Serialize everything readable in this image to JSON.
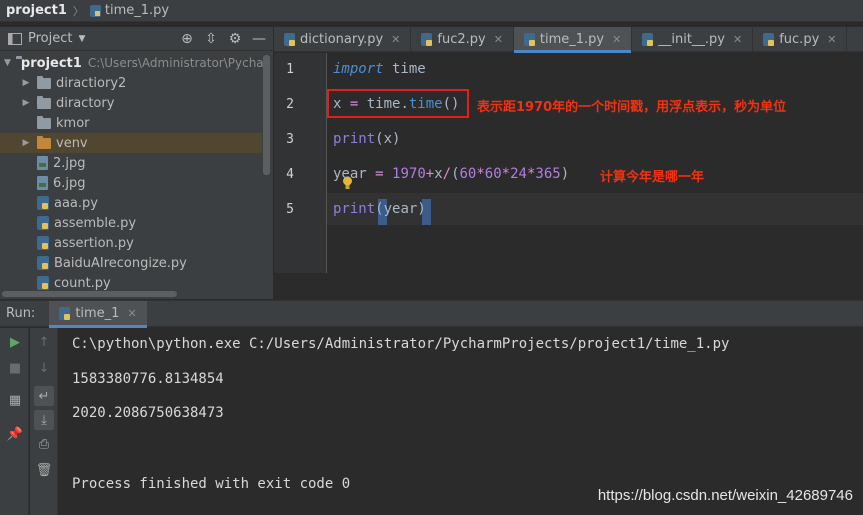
{
  "breadcrumb": {
    "project": "project1",
    "file": "time_1.py"
  },
  "project_panel": {
    "title": "Project",
    "tree": [
      {
        "name": "project1",
        "path": "C:\\Users\\Administrator\\Pychar",
        "type": "folder",
        "expanded": true
      },
      {
        "name": "diractiory2",
        "type": "folder",
        "expanded": false
      },
      {
        "name": "diractory",
        "type": "folder",
        "expanded": false
      },
      {
        "name": "kmor",
        "type": "folder"
      },
      {
        "name": "venv",
        "type": "folder-brown",
        "expanded": false,
        "highlighted": true
      },
      {
        "name": "2.jpg",
        "type": "image"
      },
      {
        "name": "6.jpg",
        "type": "image"
      },
      {
        "name": "aaa.py",
        "type": "python"
      },
      {
        "name": "assemble.py",
        "type": "python"
      },
      {
        "name": "assertion.py",
        "type": "python"
      },
      {
        "name": "BaiduAIrecongize.py",
        "type": "python"
      },
      {
        "name": "count.py",
        "type": "python"
      }
    ]
  },
  "tabs": [
    {
      "label": "dictionary.py",
      "active": false
    },
    {
      "label": "fuc2.py",
      "active": false
    },
    {
      "label": "time_1.py",
      "active": true
    },
    {
      "label": "__init__.py",
      "active": false
    },
    {
      "label": "fuc.py",
      "active": false
    }
  ],
  "editor": {
    "line_numbers": [
      "1",
      "2",
      "3",
      "4",
      "5"
    ],
    "lines": {
      "l1": {
        "kw": "import",
        "rest": " time"
      },
      "l2": {
        "a": "x ",
        "eq": "=",
        "b": " time.",
        "fn": "time",
        "c": "()"
      },
      "l3": {
        "bi": "print",
        "rest": "(x)"
      },
      "l4": {
        "a": "year ",
        "eq": "=",
        "b": " ",
        "n1": "1970",
        "plus": "+",
        "c": "x",
        "div": "/",
        "d": "(",
        "n2": "60",
        "m1": "*",
        "n3": "60",
        "m2": "*",
        "n4": "24",
        "m3": "*",
        "n5": "365",
        "e": ")"
      },
      "l5": {
        "bi": "print",
        "lp": "(",
        "arg": "year",
        "rp": ")"
      }
    },
    "annotations": {
      "line2": "表示距1970年的一个时间戳，用浮点表示，秒为单位",
      "line4": "计算今年是哪一年"
    }
  },
  "run": {
    "label": "Run:",
    "tab": "time_1",
    "output": [
      "C:\\python\\python.exe C:/Users/Administrator/PycharmProjects/project1/time_1.py",
      "1583380776.8134854",
      "2020.2086750638473",
      "",
      "Process finished with exit code 0"
    ]
  },
  "watermark": "https://blog.csdn.net/weixin_42689746"
}
